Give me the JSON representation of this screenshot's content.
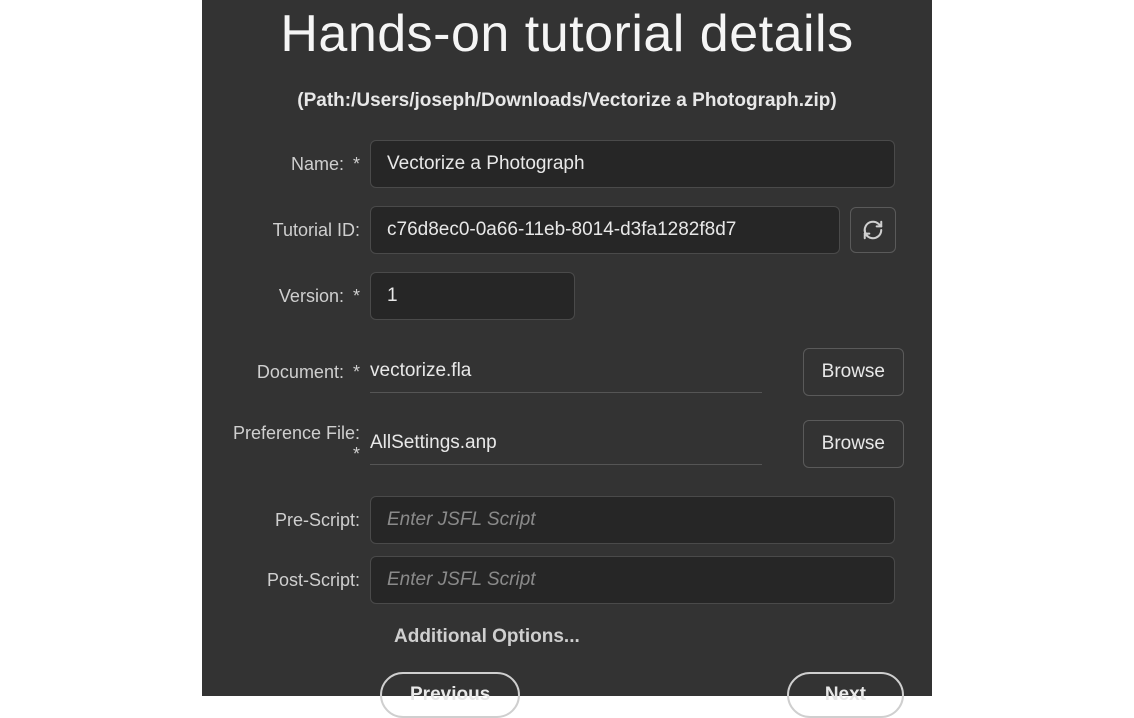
{
  "title": "Hands-on tutorial details",
  "path": "(Path:/Users/joseph/Downloads/Vectorize a Photograph.zip)",
  "form": {
    "name": {
      "label": "Name:",
      "value": "Vectorize a Photograph"
    },
    "tutorial_id": {
      "label": "Tutorial ID:",
      "value": "c76d8ec0-0a66-11eb-8014-d3fa1282f8d7"
    },
    "version": {
      "label": "Version:",
      "value": "1"
    },
    "document": {
      "label": "Document:",
      "value": "vectorize.fla",
      "browse": "Browse"
    },
    "preference_file": {
      "label": "Preference File:",
      "value": "AllSettings.anp",
      "browse": "Browse"
    },
    "pre_script": {
      "label": "Pre-Script:",
      "placeholder": "Enter JSFL Script",
      "value": ""
    },
    "post_script": {
      "label": "Post-Script:",
      "placeholder": "Enter JSFL Script",
      "value": ""
    },
    "additional_options": "Additional Options..."
  },
  "nav": {
    "previous": "Previous",
    "next": "Next"
  },
  "required_marker": "*"
}
